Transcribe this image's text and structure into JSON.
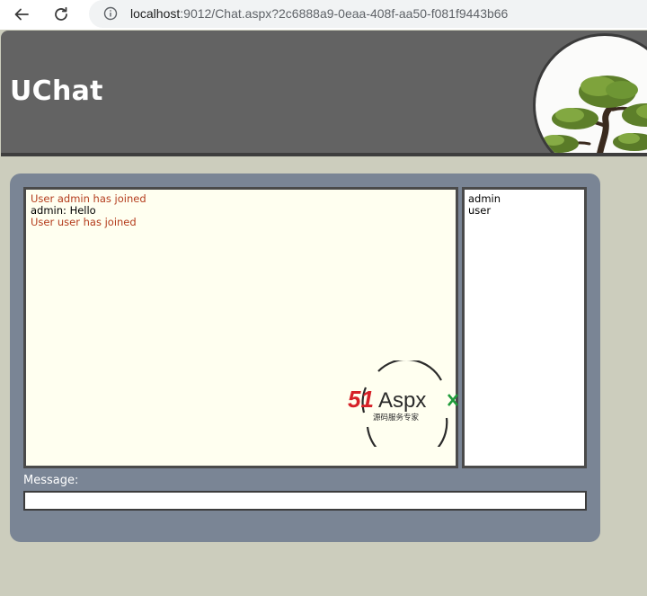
{
  "browser": {
    "url_host": "localhost",
    "url_rest": ":9012/Chat.aspx?2c6888a9-0eaa-408f-aa50-f081f9443b66"
  },
  "header": {
    "title": "UChat"
  },
  "chat": {
    "messages": [
      {
        "type": "system",
        "text": "User admin has joined"
      },
      {
        "type": "user",
        "text": "admin: Hello"
      },
      {
        "type": "system",
        "text": "User user has joined"
      }
    ],
    "users": [
      "admin",
      "user"
    ],
    "message_label": "Message:",
    "message_value": ""
  },
  "watermark": {
    "brand_red": "51",
    "brand_dark": "Aspx",
    "tagline": "源码服务专家"
  },
  "colors": {
    "header_bg": "#636363",
    "page_bg": "#cccdbd",
    "panel_bg": "#7a8595",
    "system_msg": "#b43c1c",
    "messages_bg": "#fffff0"
  }
}
